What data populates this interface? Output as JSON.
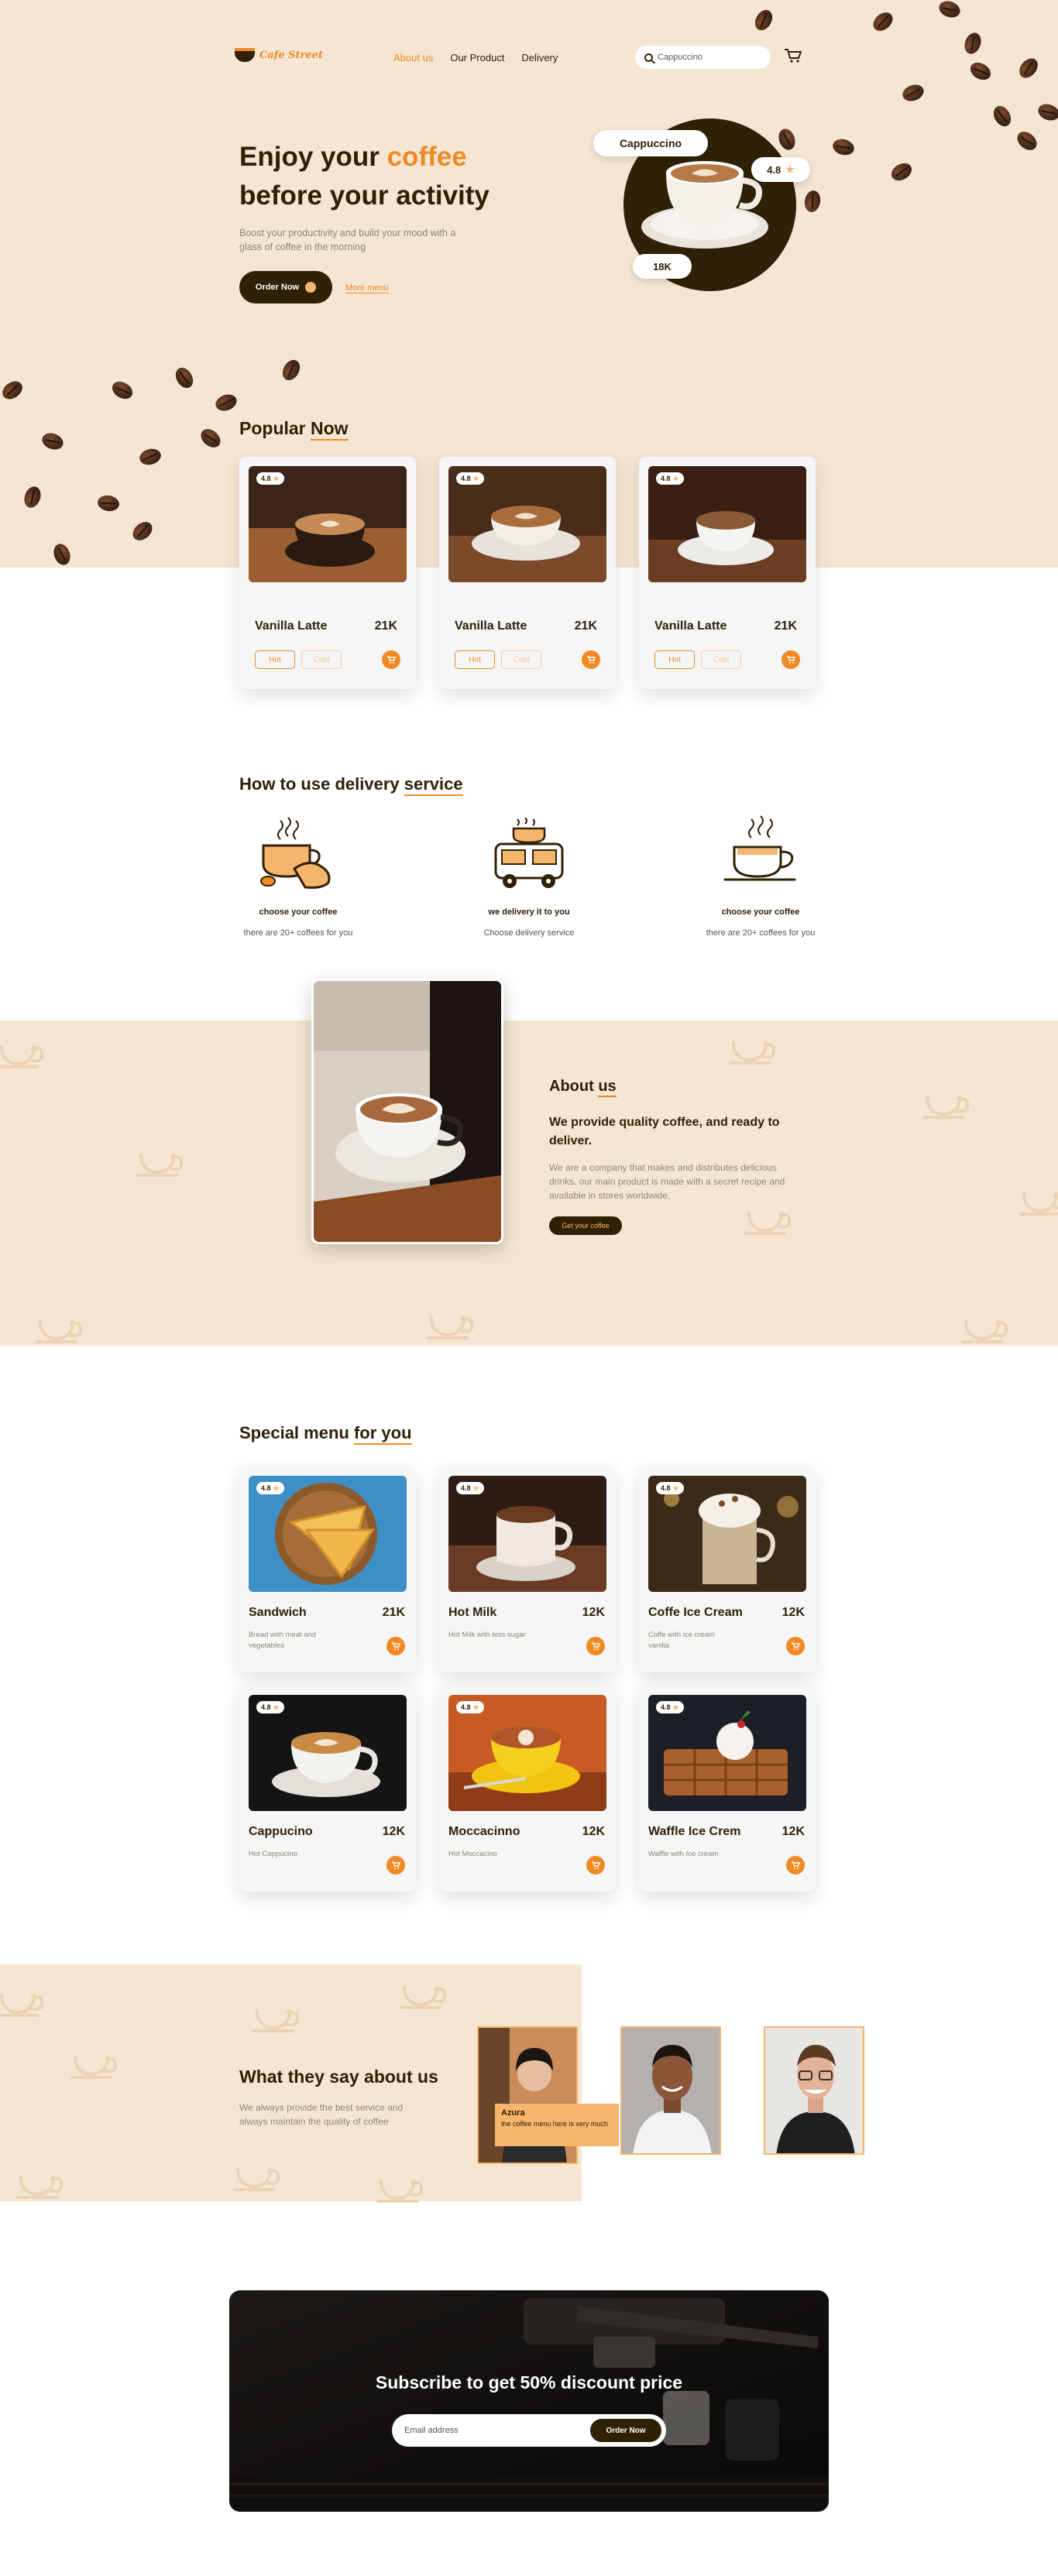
{
  "brand": {
    "name": "Cafe Street",
    "accent": "#f08a24",
    "dark": "#2f2105",
    "cream": "#f5e6d3"
  },
  "nav": {
    "items": [
      "About us",
      "Our Product",
      "Delivery"
    ],
    "active": "About us"
  },
  "search": {
    "value": "Cappuccino"
  },
  "hero": {
    "title_line1_a": "Enjoy your ",
    "title_line1_b": "coffee",
    "title_line2": "before your activity",
    "subtitle": "Boost your productivity and build your mood with a glass of coffee in the morning",
    "order_button": "Order Now",
    "more_link": "More menu",
    "badge_name": "Cappuccino",
    "badge_rating": "4.8",
    "badge_likes": "18K"
  },
  "popular": {
    "title_a": "Popular ",
    "title_b": "Now",
    "items": [
      {
        "rating": "4.8",
        "name": "Vanilla Latte",
        "price": "21K",
        "hot": "Hot",
        "cold": "Cold"
      },
      {
        "rating": "4.8",
        "name": "Vanilla Latte",
        "price": "21K",
        "hot": "Hot",
        "cold": "Cold"
      },
      {
        "rating": "4.8",
        "name": "Vanilla Latte",
        "price": "21K",
        "hot": "Hot",
        "cold": "Cold"
      }
    ]
  },
  "delivery": {
    "title_a": "How to use delivery ",
    "title_b": "service",
    "steps": [
      {
        "icon": "coffee-hand-icon",
        "title": "choose your coffee",
        "sub": "there are 20+ coffees for you"
      },
      {
        "icon": "delivery-van-icon",
        "title": "we delivery it to you",
        "sub": "Choose delivery service"
      },
      {
        "icon": "coffee-cup-icon",
        "title": "choose your coffee",
        "sub": "there are 20+ coffees for you"
      }
    ]
  },
  "about": {
    "title_a": "About ",
    "title_b": "us",
    "heading": "We provide quality coffee, and ready to deliver.",
    "text": "We are a company that makes and distributes delicious drinks. our main product is made with a secret recipe and available in stores worldwide.",
    "button": "Get your coffee"
  },
  "special": {
    "title_a": "Special menu ",
    "title_b": "for you",
    "items": [
      {
        "rating": "4.8",
        "name": "Sandwich",
        "price": "21K",
        "desc": "Bread with meat and vegetables"
      },
      {
        "rating": "4.8",
        "name": "Hot Milk",
        "price": "12K",
        "desc": "Hot Milk with less sugar"
      },
      {
        "rating": "4.8",
        "name": "Coffe Ice Cream",
        "price": "12K",
        "desc": "Coffe with ice cream vanilla"
      },
      {
        "rating": "4.8",
        "name": "Cappucino",
        "price": "12K",
        "desc": "Hot Cappucino"
      },
      {
        "rating": "4.8",
        "name": "Moccacinno",
        "price": "12K",
        "desc": "Hot Moccacino"
      },
      {
        "rating": "4.8",
        "name": "Waffle Ice Crem",
        "price": "12K",
        "desc": "Waffle with Ice cream"
      }
    ]
  },
  "testimonials": {
    "title": "What they say about us",
    "text": "We always provide the best service and always maintain the quality of coffee",
    "quote_name": "Azura",
    "quote_text": "the coffee menu here is very much"
  },
  "subscribe": {
    "title": "Subscribe to get 50% discount price",
    "placeholder": "Email address",
    "button": "Order Now"
  }
}
